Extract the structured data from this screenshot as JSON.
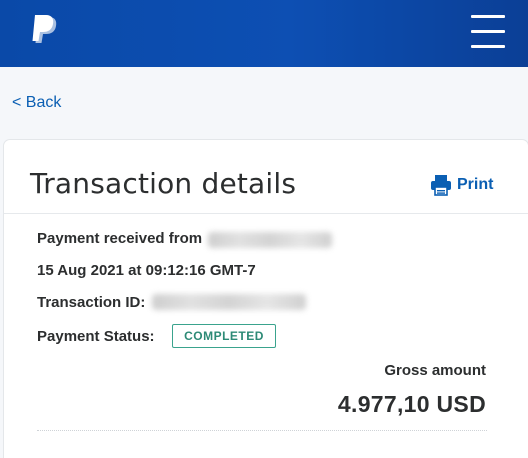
{
  "header": {
    "logo_icon": "paypal-logo-icon",
    "menu_icon": "hamburger-menu-icon",
    "background_color": "#0d4fb3"
  },
  "nav": {
    "back_label": "< Back"
  },
  "card": {
    "title": "Transaction details",
    "print_label": "Print",
    "print_icon": "printer-icon",
    "payment_received_label": "Payment received from",
    "date_time": "15 Aug 2021 at 09:12:16 GMT-7",
    "transaction_id_label": "Transaction ID:",
    "payment_status_label": "Payment Status:",
    "payment_status_value": "COMPLETED",
    "gross_amount_label": "Gross amount",
    "gross_amount_value": "4.977,10 USD"
  },
  "colors": {
    "accent": "#0b5fb3",
    "status": "#2d8a76"
  }
}
